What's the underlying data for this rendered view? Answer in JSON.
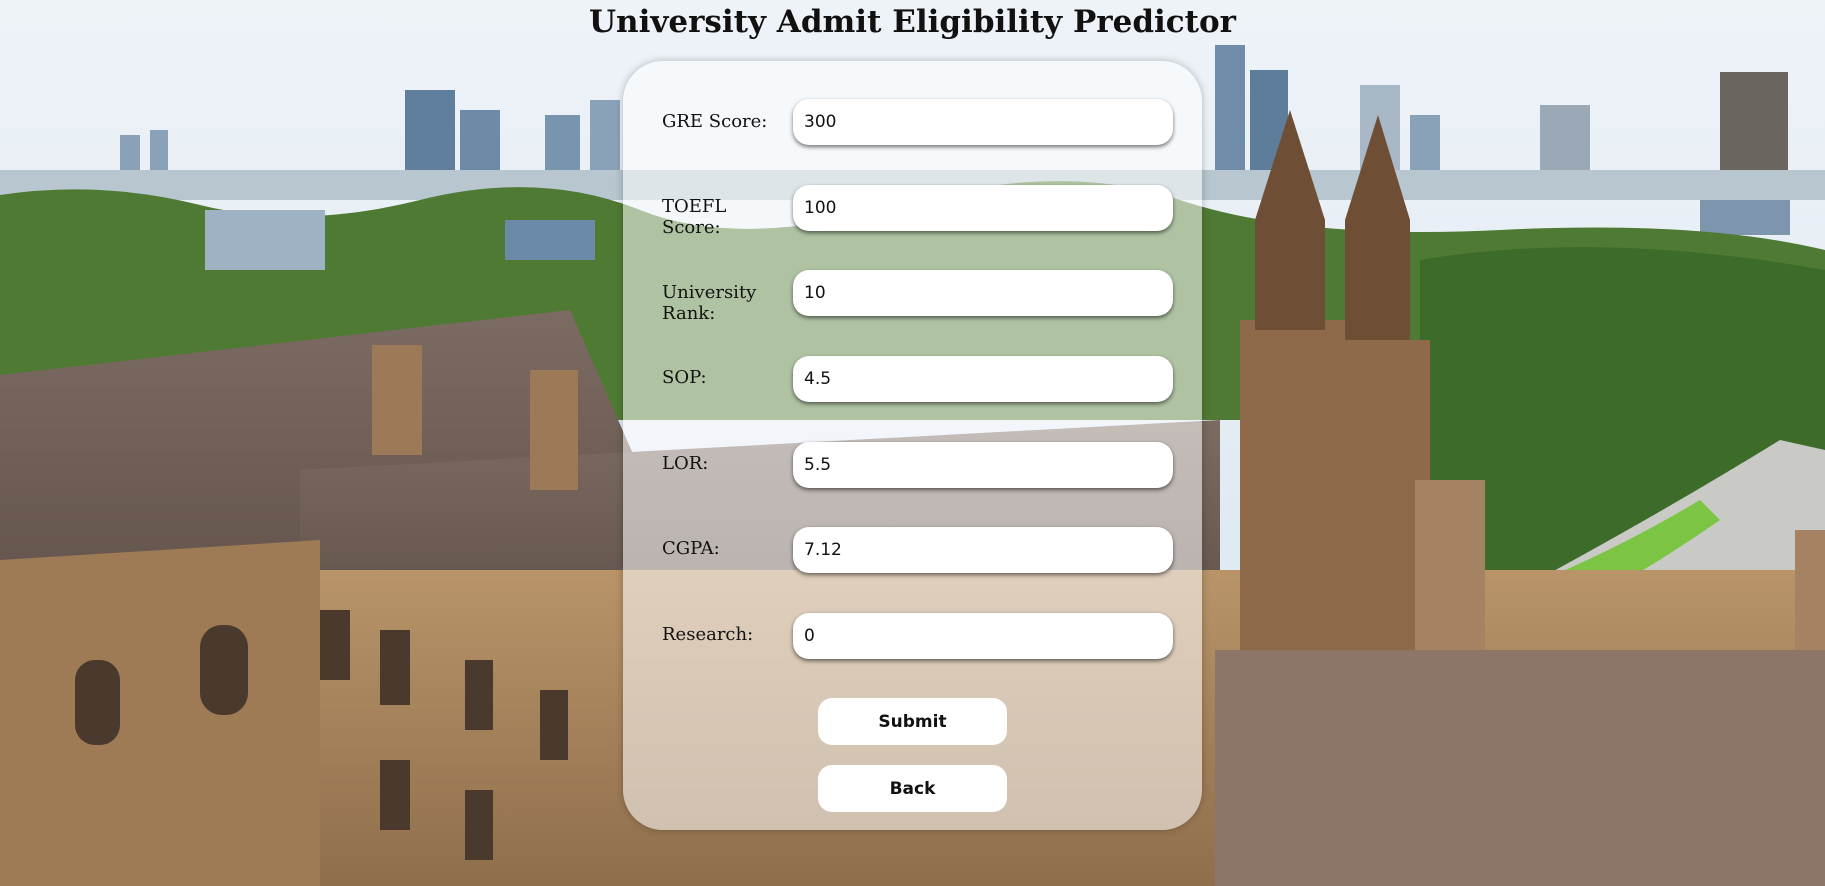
{
  "header": {
    "title": "University Admit Eligibility Predictor"
  },
  "form": {
    "fields": [
      {
        "label": "GRE Score:",
        "value": "300"
      },
      {
        "label": "TOEFL Score:",
        "value": "100"
      },
      {
        "label": "University Rank:",
        "value": "10"
      },
      {
        "label": "SOP:",
        "value": "4.5"
      },
      {
        "label": "LOR:",
        "value": "5.5"
      },
      {
        "label": "CGPA:",
        "value": "7.12"
      },
      {
        "label": "Research:",
        "value": "0"
      }
    ],
    "submit_label": "Submit",
    "back_label": "Back"
  },
  "colors": {
    "card_bg": "#ffffff",
    "sky": "#dfeaf3",
    "sandstone": "#b08b62",
    "trees": "#3f6e2c"
  }
}
